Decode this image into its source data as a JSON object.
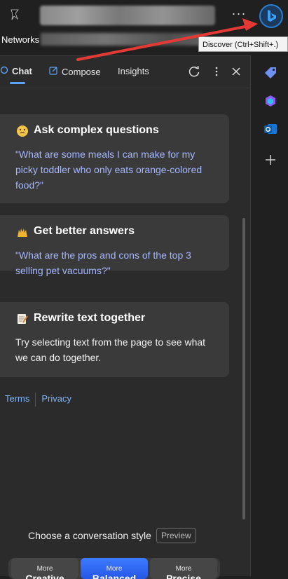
{
  "browser": {
    "tab_label": "Networks",
    "more_glyph": "···",
    "discover_tooltip": "Discover (Ctrl+Shift+.)"
  },
  "panel": {
    "tabs": [
      {
        "label": "Chat",
        "icon": "chat-icon",
        "active": true
      },
      {
        "label": "Compose",
        "icon": "compose-icon",
        "active": false
      },
      {
        "label": "Insights",
        "icon": "",
        "active": false
      }
    ],
    "cards": [
      {
        "title": "Ask complex questions",
        "emoji": "thinking-face-icon",
        "body": "\"What are some meals I can make for my picky toddler who only eats orange-colored food?\"",
        "body_style": "link"
      },
      {
        "title": "Get better answers",
        "emoji": "raised-hands-icon",
        "body": "\"What are the pros and cons of the top 3 selling pet vacuums?\"",
        "body_style": "link"
      },
      {
        "title": "Rewrite text together",
        "emoji": "memo-icon",
        "body": "Try selecting text from the page to see what we can do together.",
        "body_style": "plain"
      }
    ],
    "footer_links": [
      "Terms",
      "Privacy"
    ],
    "conversation_style": {
      "label": "Choose a conversation style",
      "badge": "Preview",
      "options": [
        {
          "top": "More",
          "mode": "Creative",
          "selected": false
        },
        {
          "top": "More",
          "mode": "Balanced",
          "selected": true
        },
        {
          "top": "More",
          "mode": "Precise",
          "selected": false
        }
      ]
    }
  },
  "sidebar": {
    "items": [
      "tag-icon",
      "copilot-icon",
      "outlook-icon",
      "add-icon"
    ]
  },
  "colors": {
    "accent": "#5ea4f6",
    "link": "#a6b7ff",
    "selected_style": "#2f6bff",
    "annotation_arrow": "#e53935"
  }
}
